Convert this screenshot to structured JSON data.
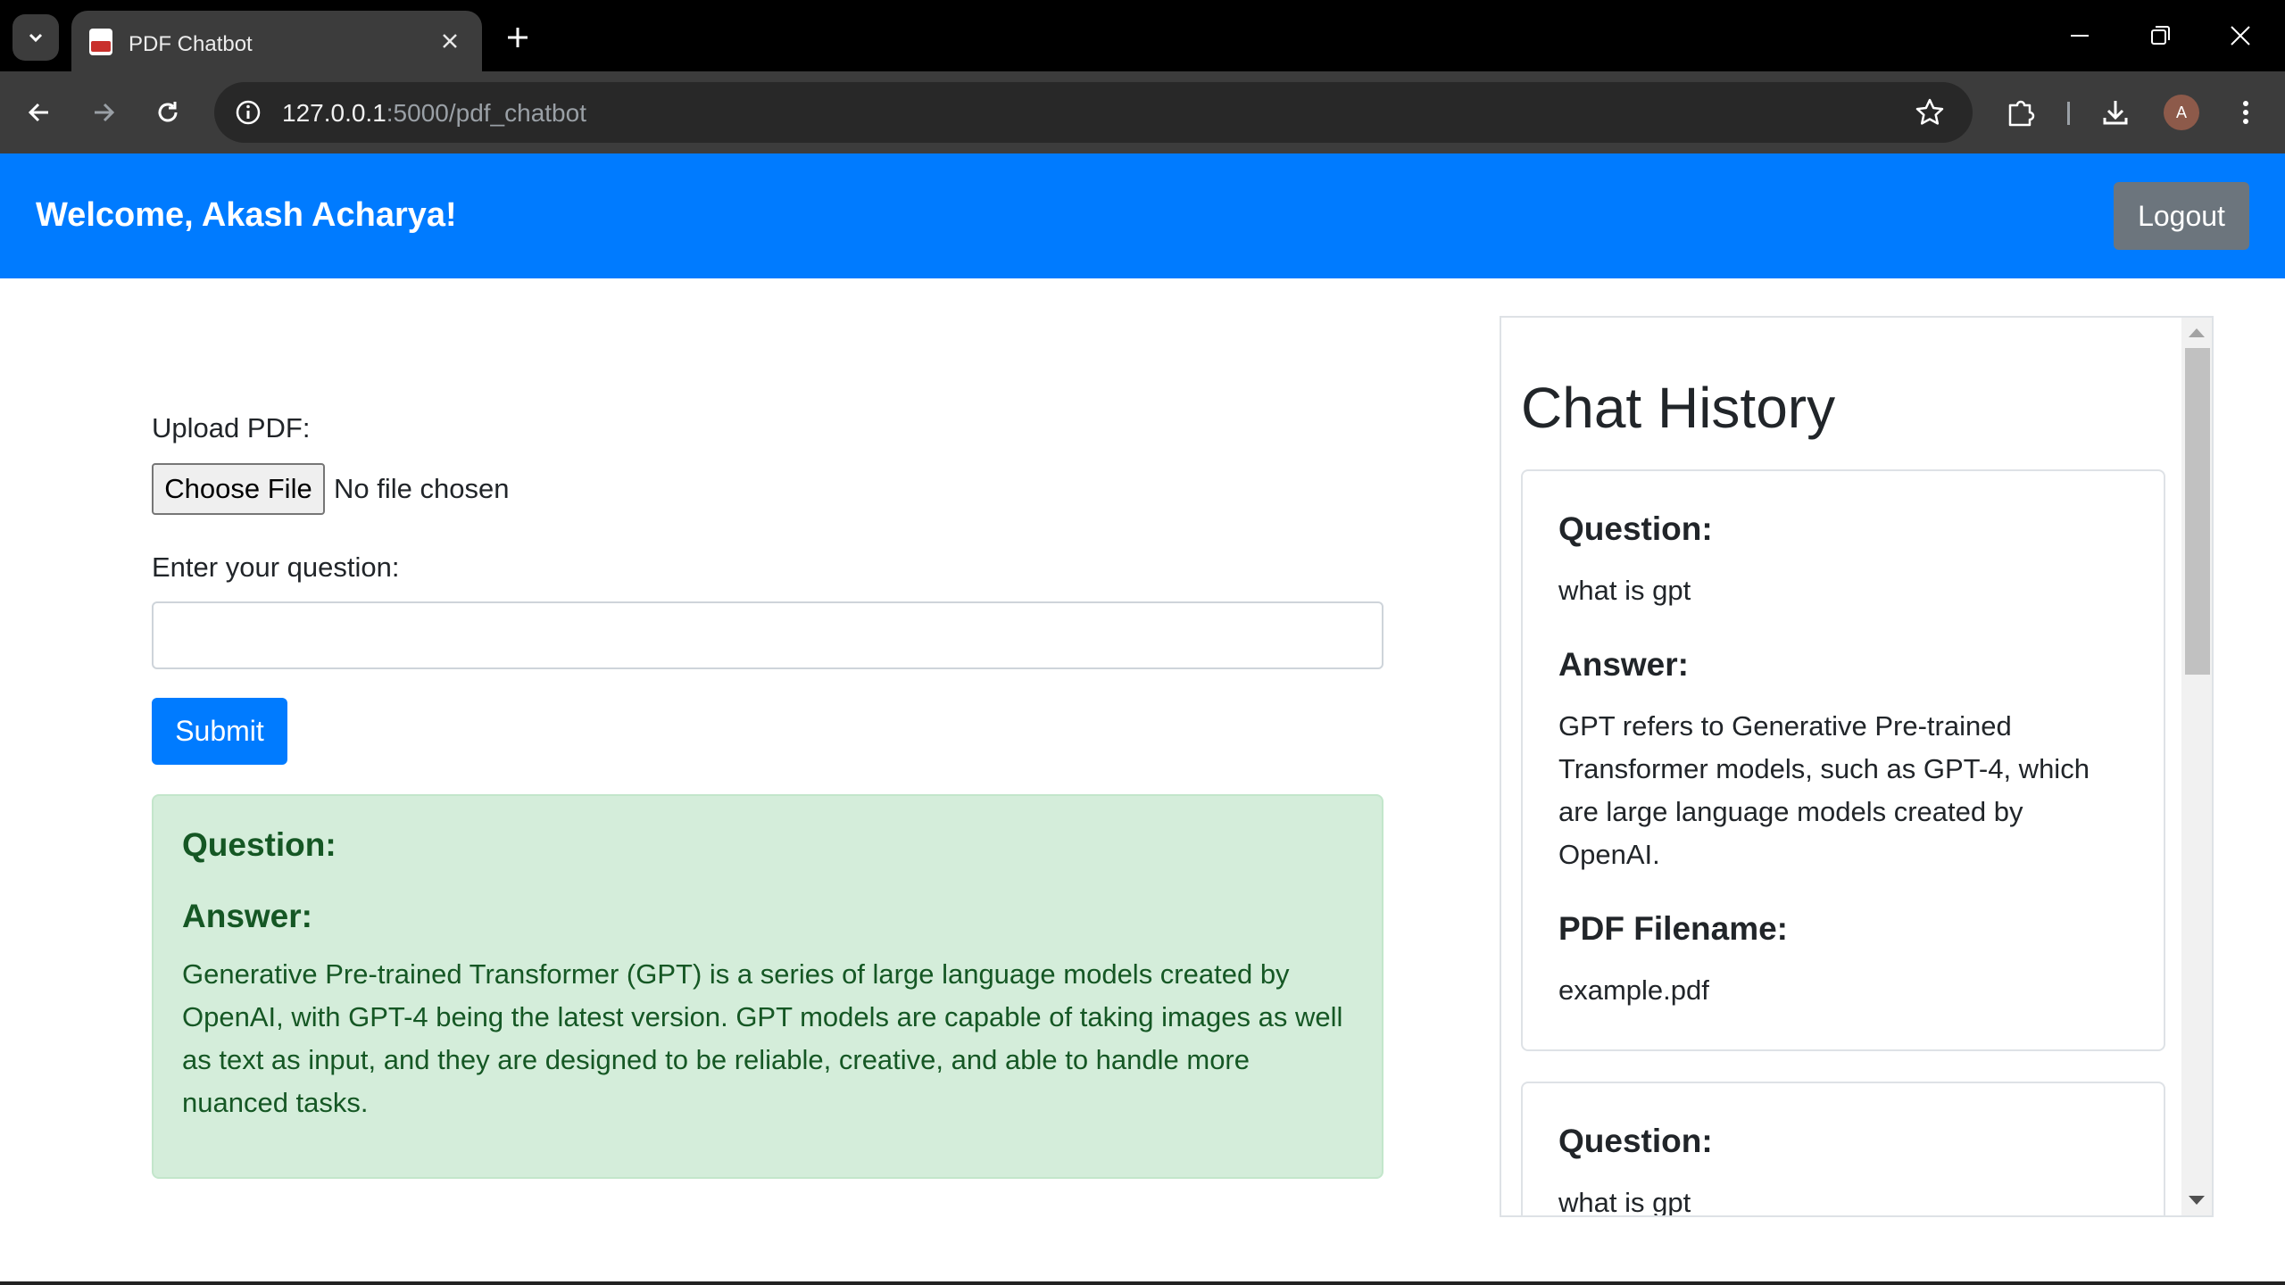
{
  "browser": {
    "tab_title": "PDF Chatbot",
    "url_host": "127.0.0.1",
    "url_rest": ":5000/pdf_chatbot",
    "profile_initial": "A"
  },
  "header": {
    "welcome": "Welcome, Akash Acharya!",
    "logout_label": "Logout"
  },
  "form": {
    "upload_label": "Upload PDF:",
    "choose_file_label": "Choose File",
    "file_status": "No file chosen",
    "question_label": "Enter your question:",
    "question_value": "",
    "submit_label": "Submit"
  },
  "result": {
    "question_heading": "Question:",
    "answer_heading": "Answer:",
    "answer_text": "Generative Pre-trained Transformer (GPT) is a series of large language models created by OpenAI, with GPT-4 being the latest version. GPT models are capable of taking images as well as text as input, and they are designed to be reliable, creative, and able to handle more nuanced tasks."
  },
  "history": {
    "title": "Chat History",
    "entries": [
      {
        "question_heading": "Question:",
        "question": "what is gpt",
        "answer_heading": "Answer:",
        "answer": "GPT refers to Generative Pre-trained Transformer models, such as GPT-4, which are large language models created by OpenAI.",
        "filename_heading": "PDF Filename:",
        "filename": "example.pdf"
      },
      {
        "question_heading": "Question:",
        "question": "what is gpt"
      }
    ]
  },
  "colors": {
    "primary": "#007bff",
    "secondary": "#6c757d",
    "success_bg": "#d4edda",
    "success_text": "#155724"
  }
}
